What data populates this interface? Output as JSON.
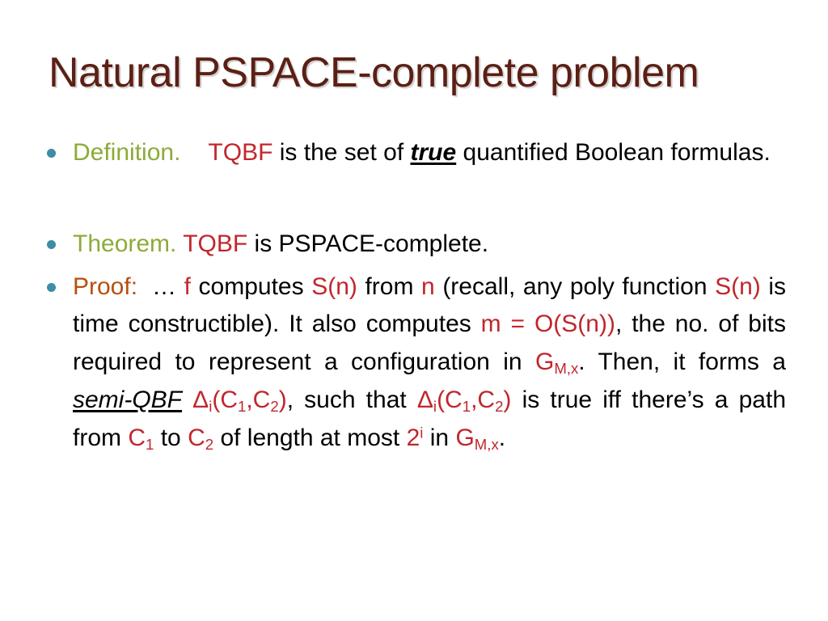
{
  "slide": {
    "title": "Natural PSPACE-complete problem",
    "colors": {
      "title": "#5C1F14",
      "green": "#8CAB37",
      "red": "#C0272D",
      "orange": "#B5500E",
      "bullet": "#3E8CA6",
      "body": "#000000",
      "background": "#ffffff"
    }
  },
  "bullets": [
    {
      "id": "definition",
      "label": "Definition.",
      "label_color": "green",
      "runs": {
        "term": "TQBF",
        "t1": "is the set of",
        "emph": "true",
        "t2": "quantified Boolean formulas."
      }
    },
    {
      "id": "theorem",
      "label": "Theorem.",
      "label_color": "green",
      "runs": {
        "term": "TQBF",
        "t1": "is PSPACE-complete."
      }
    },
    {
      "id": "proof",
      "label": "Proof:",
      "label_color": "orange",
      "runs": {
        "ellipsis": "…",
        "f": "f",
        "t1": "computes",
        "sn1": "S(n)",
        "t2": "from",
        "n": "n",
        "t3": "(recall, any poly function",
        "sn2": "S(n)",
        "t4": "is time constructible). It also computes",
        "m_eq": "m = O(S(n))",
        "t5": ", the no. of bits required to represent a configuration in",
        "g1_base": "G",
        "g1_sub": "M,x",
        "t6": ". Then, it forms a",
        "semi": "semi-QBF",
        "delta1_base": "Δ",
        "delta1_sub": "i",
        "delta1_open": "(C",
        "delta1_c1sub": "1",
        "delta1_mid": ",C",
        "delta1_c2sub": "2",
        "delta1_close": ")",
        "t7": ", such that",
        "delta2_base": "Δ",
        "delta2_sub": "i",
        "delta2_open": "(C",
        "delta2_c1sub": "1",
        "delta2_mid": ",C",
        "delta2_c2sub": "2",
        "delta2_close": ")",
        "t8": "is true iff there’s a path from",
        "c1_base": "C",
        "c1_sub": "1",
        "t9": "to",
        "c2_base": "C",
        "c2_sub": "2",
        "t10": "of length at most",
        "two_base": "2",
        "two_sup": "i",
        "t11": "in",
        "g2_base": "G",
        "g2_sub": "M,x",
        "t12": "."
      }
    }
  ]
}
